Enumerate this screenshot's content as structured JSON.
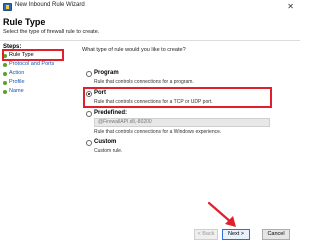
{
  "window": {
    "title": "New Inbound Rule Wizard",
    "close_glyph": "✕"
  },
  "header": {
    "title": "Rule Type",
    "description": "Select the type of firewall rule to create."
  },
  "steps": {
    "heading": "Steps:",
    "items": [
      {
        "label": "Rule Type",
        "active": true
      },
      {
        "label": "Protocol and Ports",
        "active": false
      },
      {
        "label": "Action",
        "active": false
      },
      {
        "label": "Profile",
        "active": false
      },
      {
        "label": "Name",
        "active": false
      }
    ]
  },
  "main": {
    "question": "What type of rule would you like to create?",
    "options": [
      {
        "label": "Program",
        "desc": "Rule that controls connections for a program.",
        "selected": false
      },
      {
        "label": "Port",
        "desc": "Rule that controls connections for a TCP or UDP port.",
        "selected": true
      },
      {
        "label": "Predefined:",
        "desc": "Rule that controls connections for a Windows experience.",
        "selected": false
      },
      {
        "label": "Custom",
        "desc": "Custom rule.",
        "selected": false
      }
    ],
    "predefined_value": "@FirewallAPI.dll,-80200"
  },
  "buttons": {
    "back": "< Back",
    "next": "Next >",
    "cancel": "Cancel"
  },
  "colors": {
    "highlight": "#e0202a",
    "step_dot": "#5aa02c",
    "link": "#1a56b0"
  }
}
